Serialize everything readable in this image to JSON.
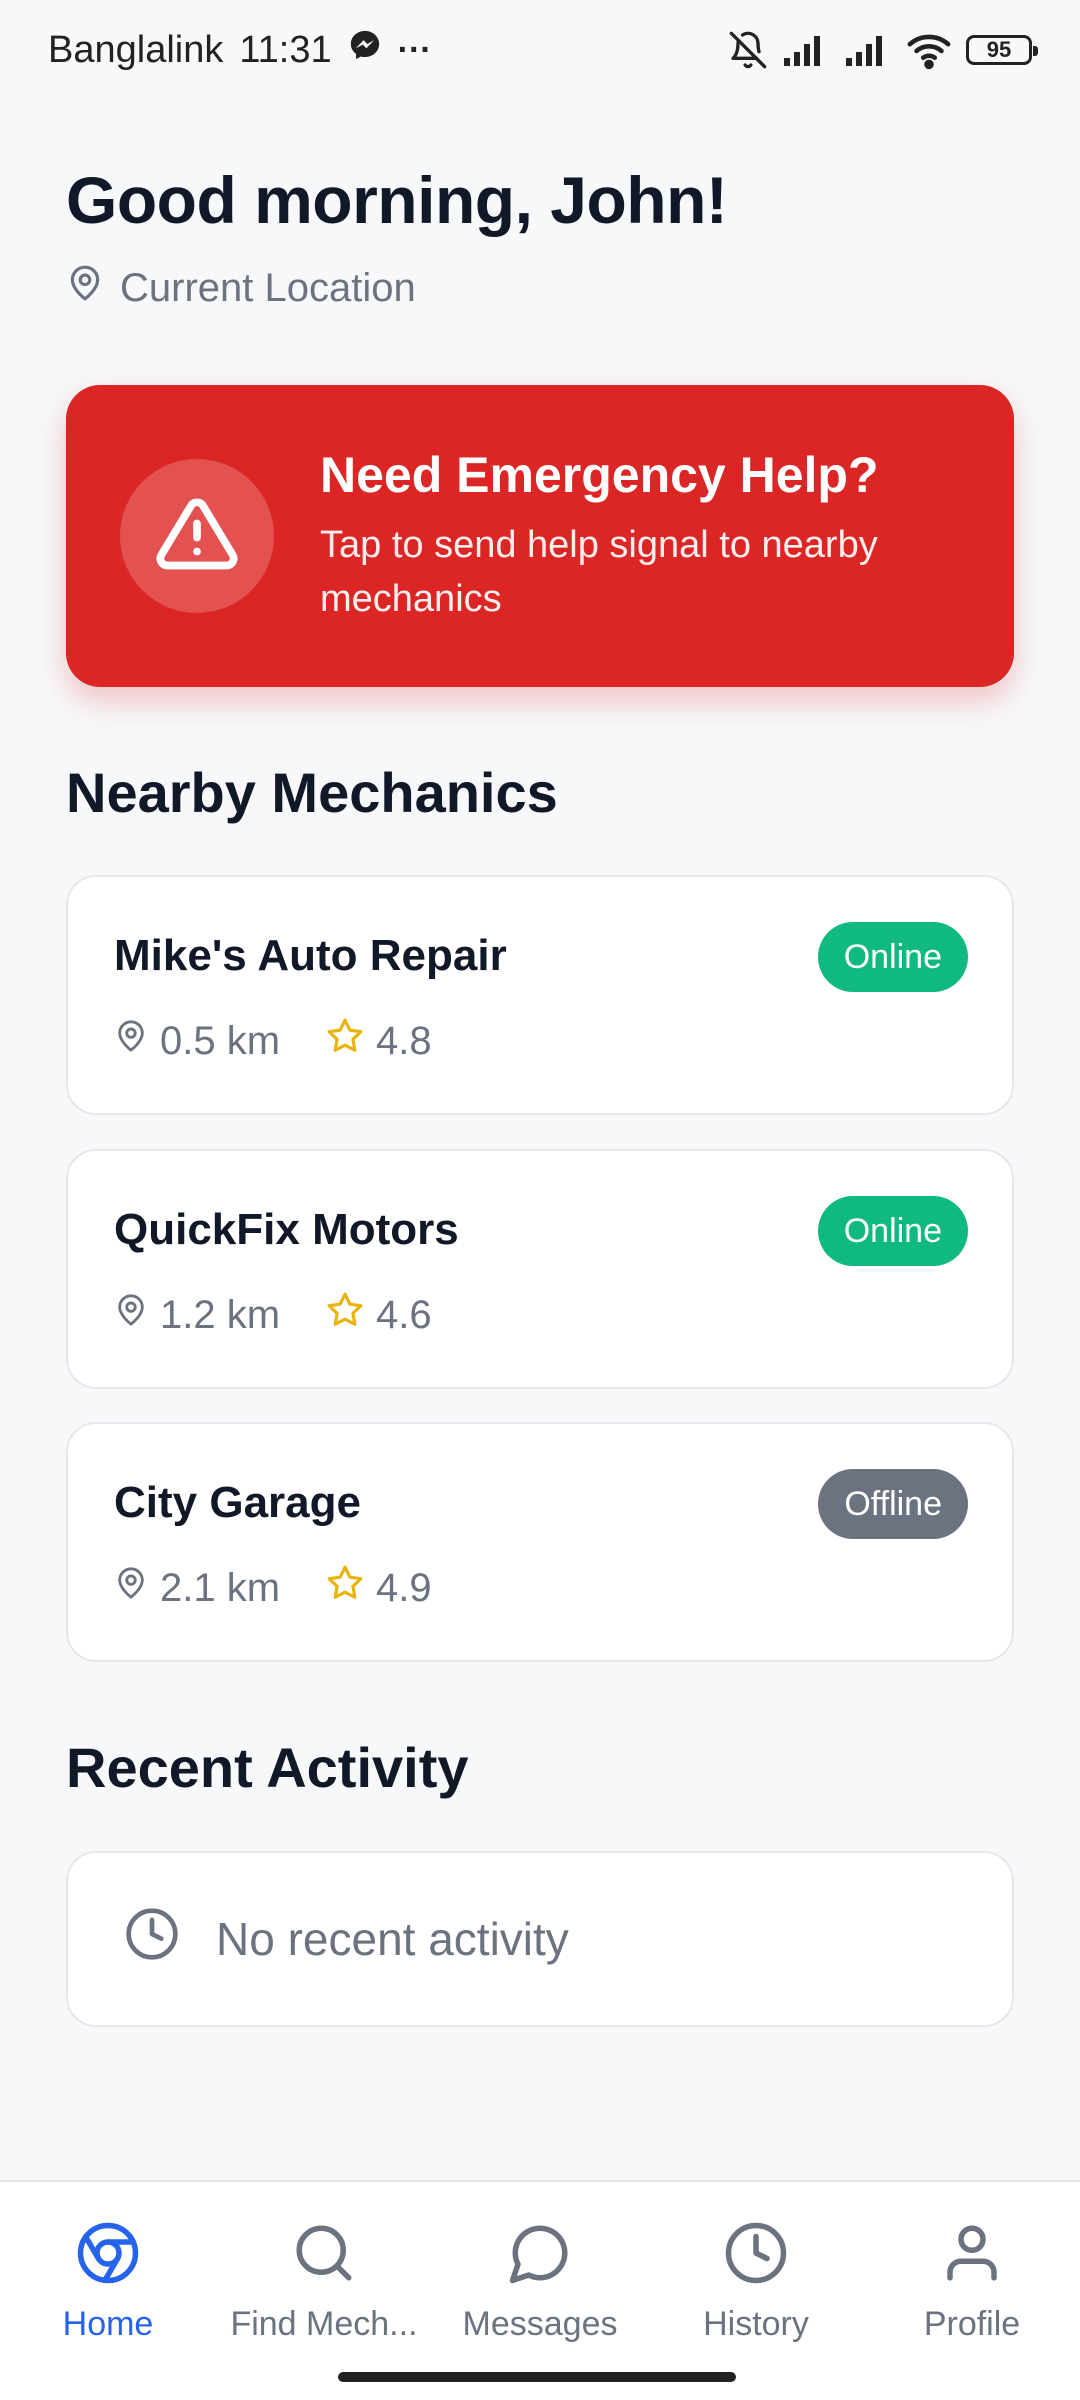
{
  "status_bar": {
    "carrier": "Banglalink",
    "time": "11:31",
    "more": "···",
    "battery": "95"
  },
  "header": {
    "greeting": "Good morning, John!",
    "location": "Current Location"
  },
  "emergency": {
    "title": "Need Emergency Help?",
    "subtitle": "Tap to send help signal to nearby mechanics",
    "color": "#dc2626"
  },
  "nearby": {
    "title": "Nearby Mechanics",
    "mechanics": [
      {
        "name": "Mike's Auto Repair",
        "distance": "0.5 km",
        "rating": "4.8",
        "status": "Online"
      },
      {
        "name": "QuickFix Motors",
        "distance": "1.2 km",
        "rating": "4.6",
        "status": "Online"
      },
      {
        "name": "City Garage",
        "distance": "2.1 km",
        "rating": "4.9",
        "status": "Offline"
      }
    ]
  },
  "recent": {
    "title": "Recent Activity",
    "empty_text": "No recent activity"
  },
  "nav": {
    "items": [
      {
        "label": "Home",
        "icon": "home-icon"
      },
      {
        "label": "Find Mech...",
        "icon": "search-icon"
      },
      {
        "label": "Messages",
        "icon": "message-icon"
      },
      {
        "label": "History",
        "icon": "clock-icon"
      },
      {
        "label": "Profile",
        "icon": "user-icon"
      }
    ],
    "active_color": "#2563eb"
  },
  "colors": {
    "online": "#10b981",
    "offline": "#6b7280",
    "star": "#eab308"
  }
}
